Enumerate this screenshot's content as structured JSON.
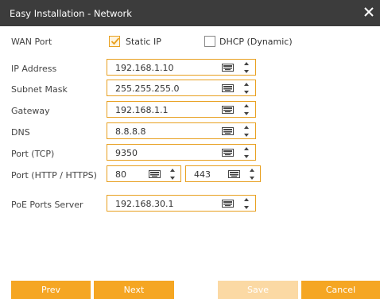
{
  "window": {
    "title": "Easy Installation - Network"
  },
  "icons": {
    "close": "close-icon",
    "keyboard": "keyboard-icon",
    "spin_up": "chevron-up-icon",
    "spin_down": "chevron-down-icon",
    "check": "check-icon"
  },
  "colors": {
    "accent": "#f5a623",
    "border": "#e8a020",
    "disabled": "#fbd9a4",
    "titlebar": "#3c3c3c"
  },
  "wan": {
    "label": "WAN Port",
    "static_label": "Static IP",
    "static_checked": true,
    "dhcp_label": "DHCP (Dynamic)",
    "dhcp_checked": false
  },
  "fields": {
    "ip": {
      "label": "IP Address",
      "value": "192.168.1.10"
    },
    "subnet": {
      "label": "Subnet Mask",
      "value": "255.255.255.0"
    },
    "gateway": {
      "label": "Gateway",
      "value": "192.168.1.1"
    },
    "dns": {
      "label": "DNS",
      "value": "8.8.8.8"
    },
    "tcp": {
      "label": "Port (TCP)",
      "value": "9350"
    },
    "http": {
      "label": "Port (HTTP / HTTPS)",
      "http_value": "80",
      "https_value": "443"
    },
    "poe": {
      "label": "PoE Ports Server",
      "value": "192.168.30.1"
    }
  },
  "buttons": {
    "prev": "Prev",
    "next": "Next",
    "save": "Save",
    "cancel": "Cancel"
  }
}
